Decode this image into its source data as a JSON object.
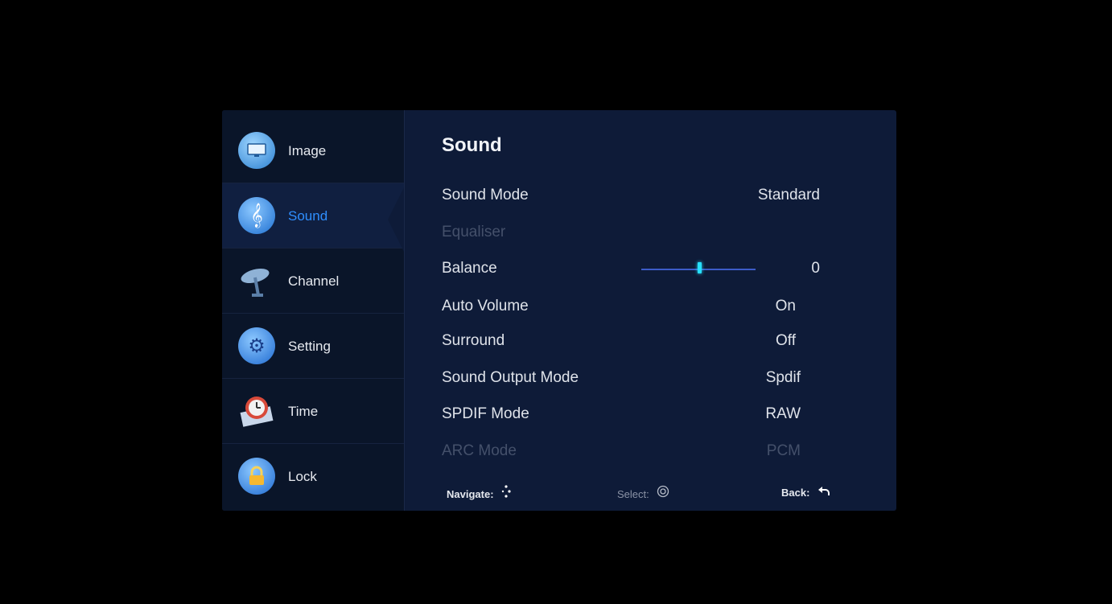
{
  "sidebar": {
    "items": [
      {
        "label": "Image",
        "icon": "monitor-icon",
        "color": "#4aa3e8"
      },
      {
        "label": "Sound",
        "icon": "music-note-icon",
        "color": "#3a8ae0"
      },
      {
        "label": "Channel",
        "icon": "satellite-dish-icon",
        "color": "#5b7fa8"
      },
      {
        "label": "Setting",
        "icon": "gear-icon",
        "color": "#2f7fe0"
      },
      {
        "label": "Time",
        "icon": "clock-icon",
        "color": "#d84a3a"
      },
      {
        "label": "Lock",
        "icon": "lock-icon",
        "color": "#3a8ae0"
      }
    ],
    "active": "Sound"
  },
  "main": {
    "title": "Sound",
    "rows": [
      {
        "label": "Sound Mode",
        "value": "Standard",
        "enabled": true
      },
      {
        "label": "Equaliser",
        "value": "",
        "enabled": false
      },
      {
        "label": "Balance",
        "value": "0",
        "enabled": true,
        "slider_fraction": 0.5
      },
      {
        "label": "Auto Volume",
        "value": "On",
        "enabled": true
      },
      {
        "label": "Surround",
        "value": "Off",
        "enabled": true
      },
      {
        "label": "Sound Output Mode",
        "value": "Spdif",
        "enabled": true
      },
      {
        "label": "SPDIF Mode",
        "value": "RAW",
        "enabled": true
      },
      {
        "label": "ARC Mode",
        "value": "PCM",
        "enabled": false
      }
    ]
  },
  "footer": {
    "navigate": "Navigate:",
    "select": "Select:",
    "back": "Back:"
  },
  "colors": {
    "active_accent": "#2f8fff",
    "slider_thumb": "#27e0ff",
    "panel_bg": "#0e1b38"
  }
}
